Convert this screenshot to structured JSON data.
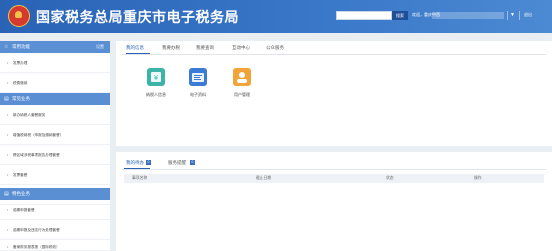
{
  "header": {
    "title": "国家税务总局重庆市电子税务局",
    "search_placeholder": "",
    "search_button": "搜索",
    "welcome": "欢迎，重庆中西",
    "exit": "退出",
    "brand_color": "#2a63b6"
  },
  "sidebar": {
    "sections": [
      {
        "title": "常用功能",
        "link": "设置",
        "items": [
          "发票办理",
          "税费缴纳"
        ]
      },
      {
        "title": "常见业务",
        "link": "",
        "items": [
          "新办纳税人套餐服务",
          "增值税纳税（申报及缴纳套餐）",
          "跨区域涉税事项报告办理套餐",
          "发票套餐",
          "涉税专业服务机构管理套餐"
        ]
      },
      {
        "title": "特色业务",
        "link": "",
        "items": [
          "逾期申报套餐",
          "逾期申报及违法行为处理套餐",
          "备案财务报表报（国际税收）"
        ]
      }
    ]
  },
  "main": {
    "tabs": [
      "我的信息",
      "我要办税",
      "我要查询",
      "互动中心",
      "公众服务"
    ],
    "active_tab": 0,
    "apps": [
      {
        "label": "纳税人信息",
        "icon": "taxpayer-info-icon",
        "color": "#3bb3a8"
      },
      {
        "label": "电子资料",
        "icon": "electronic-data-icon",
        "color": "#3a7bd5"
      },
      {
        "label": "用户管理",
        "icon": "user-management-icon",
        "color": "#f2a33a"
      }
    ]
  },
  "panel2": {
    "tabs": [
      {
        "label": "我的待办",
        "badge": "0"
      },
      {
        "label": "服务提醒",
        "badge": "0"
      }
    ],
    "columns": [
      "事项名称",
      "截止日期",
      "状态",
      "操作"
    ]
  }
}
